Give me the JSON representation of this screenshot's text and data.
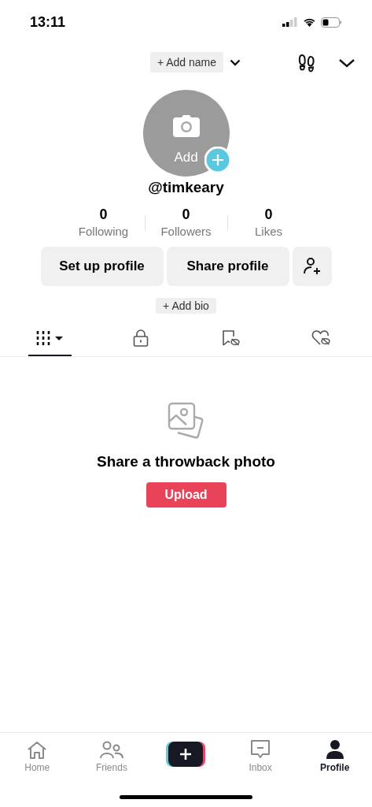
{
  "status_bar": {
    "time": "13:11"
  },
  "header": {
    "add_name": "+ Add name"
  },
  "avatar": {
    "label": "Add"
  },
  "username": "@timkeary",
  "stats": [
    {
      "value": "0",
      "label": "Following"
    },
    {
      "value": "0",
      "label": "Followers"
    },
    {
      "value": "0",
      "label": "Likes"
    }
  ],
  "buttons": [
    "Set up profile",
    "Share profile"
  ],
  "add_bio": "+ Add bio",
  "tabs": [
    {
      "kind": "grid",
      "selected": true
    },
    {
      "kind": "lock",
      "selected": false
    },
    {
      "kind": "saved",
      "selected": false
    },
    {
      "kind": "liked",
      "selected": false
    }
  ],
  "empty_state": {
    "title": "Share a throwback photo",
    "button": "Upload"
  },
  "nav": [
    {
      "kind": "home",
      "label": "Home",
      "selected": false
    },
    {
      "kind": "friends",
      "label": "Friends",
      "selected": false
    },
    {
      "kind": "create"
    },
    {
      "kind": "inbox",
      "label": "Inbox",
      "selected": false
    },
    {
      "kind": "profile",
      "label": "Profile",
      "selected": true
    }
  ]
}
